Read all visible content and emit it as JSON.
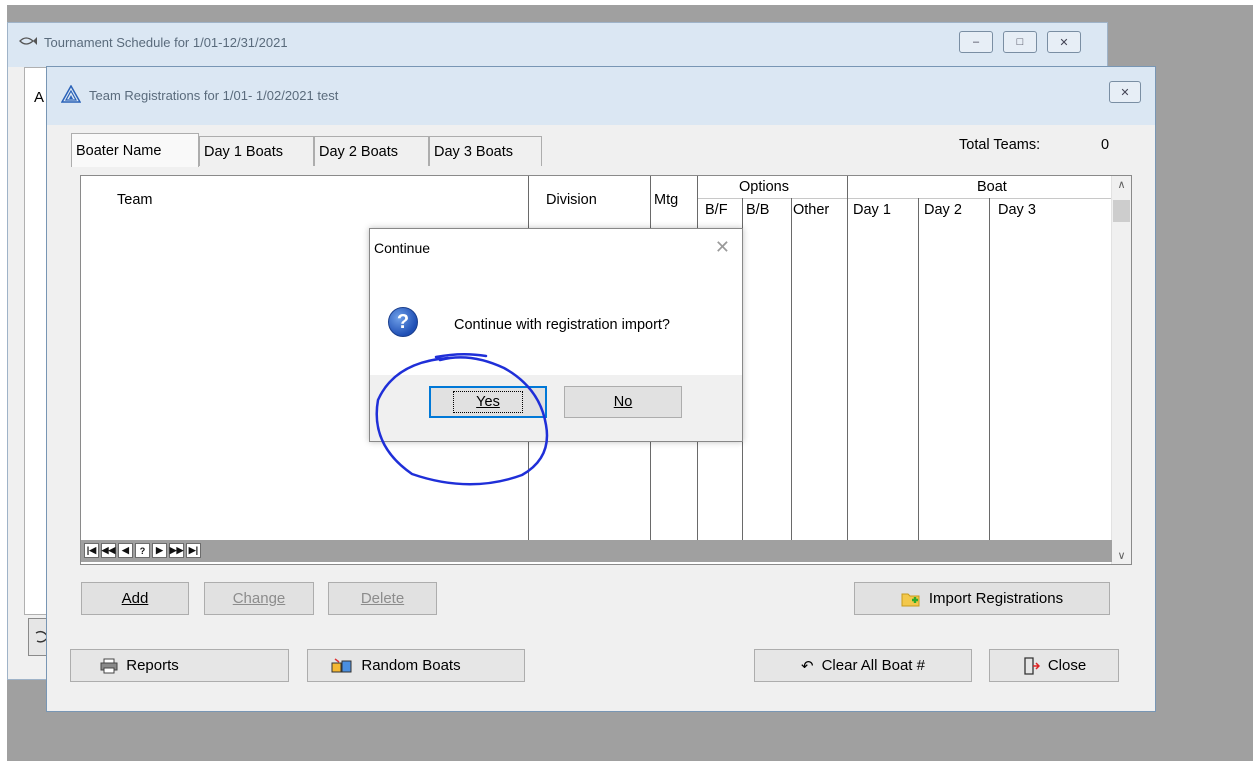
{
  "back_window": {
    "title": "Tournament Schedule for  1/01-12/31/2021",
    "controls": {
      "minimize": "–",
      "maximize": "□",
      "close": "✕"
    },
    "left_letter": "A"
  },
  "front_window": {
    "title": "Team Registrations for  1/01- 1/02/2021 test",
    "close": "✕"
  },
  "tabs": [
    {
      "label": "Boater Name"
    },
    {
      "label": "Day 1 Boats"
    },
    {
      "label": "Day 2 Boats"
    },
    {
      "label": "Day 3 Boats"
    }
  ],
  "total_teams": {
    "label": "Total Teams:",
    "value": "0"
  },
  "grid": {
    "headers": {
      "team": "Team",
      "division": "Division",
      "mtg": "Mtg",
      "options": "Options",
      "bf": "B/F",
      "bb": "B/B",
      "other": "Other",
      "boat": "Boat",
      "day1": "Day 1",
      "day2": "Day 2",
      "day3": "Day 3"
    },
    "rows": [],
    "nav_buttons": [
      "|◀",
      "◀◀",
      "◀",
      "?",
      "▶",
      "▶▶",
      "▶|"
    ]
  },
  "buttons": {
    "add": "Add",
    "change": "Change",
    "delete": "Delete",
    "import": "Import Registrations",
    "reports": "Reports",
    "random_boats": "Random Boats",
    "clear_all": "Clear All Boat #",
    "close": "Close"
  },
  "dialog": {
    "title": "Continue",
    "message": "Continue with registration import?",
    "yes": "Yes",
    "no": "No",
    "icon": "question-icon"
  },
  "colors": {
    "titlebar": "#dbe7f3",
    "desktop": "#a0a0a0",
    "annotation": "#1f2fd8",
    "focus": "#0078d7"
  }
}
